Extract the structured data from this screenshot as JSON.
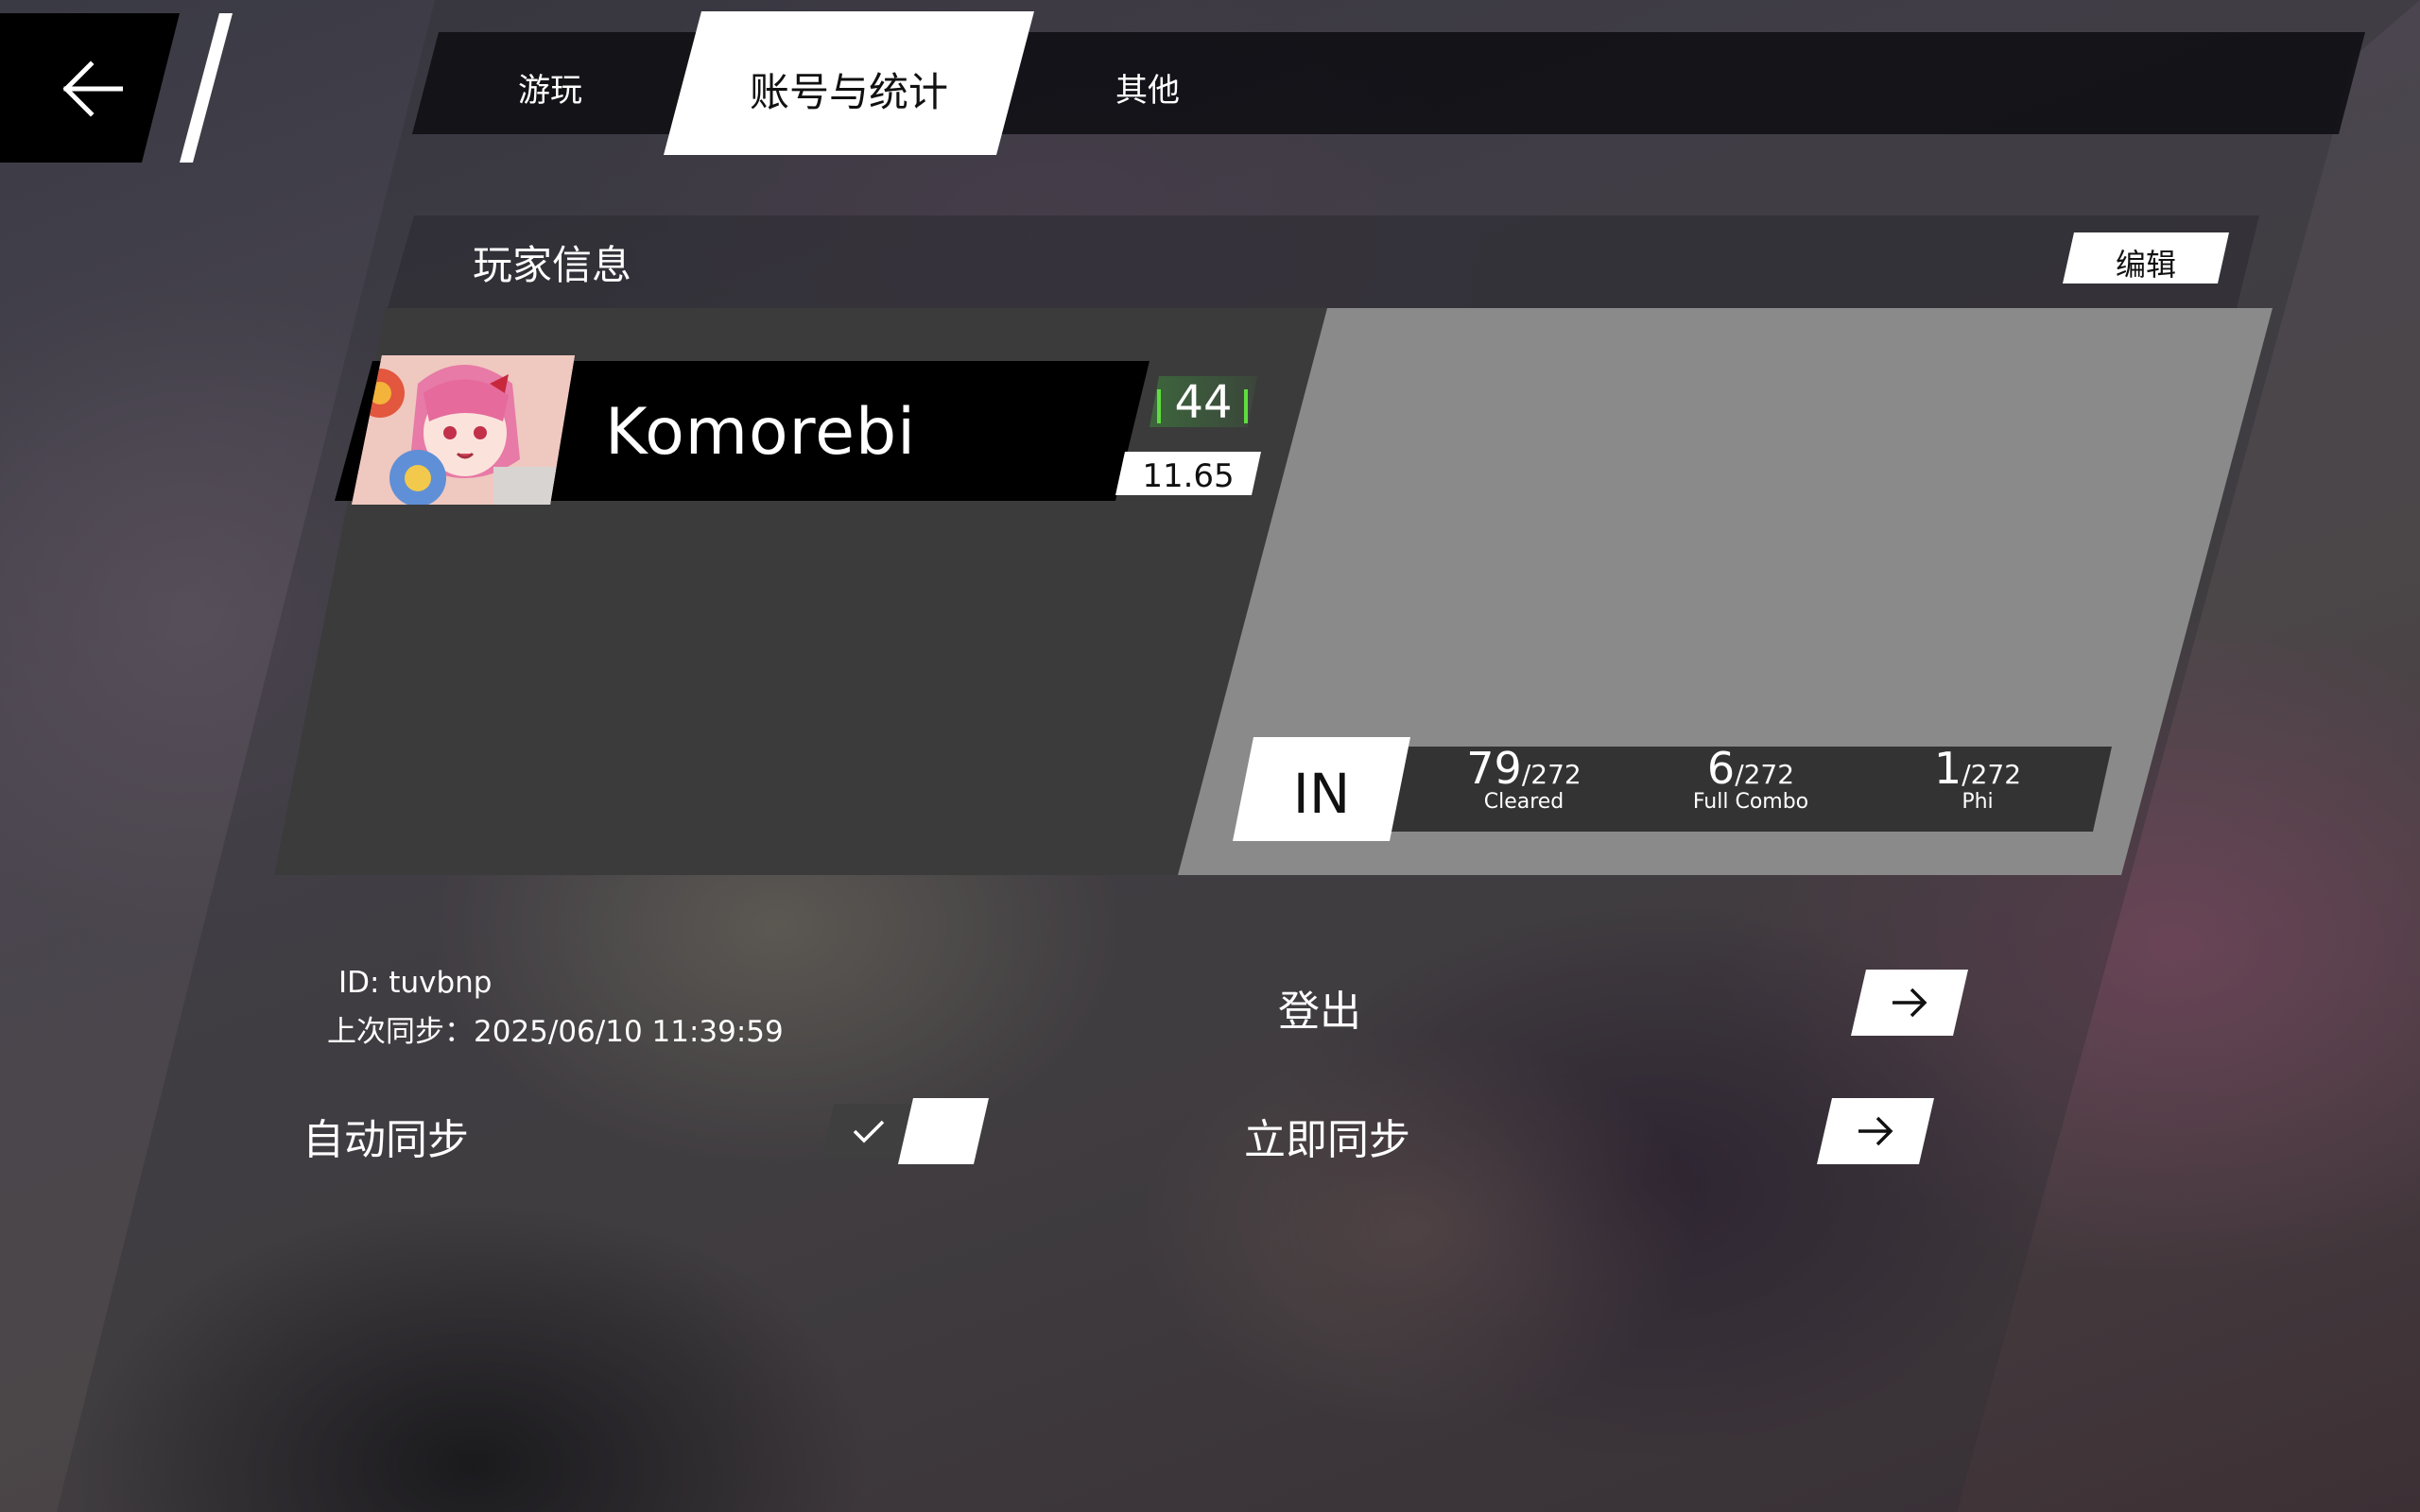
{
  "tabs": [
    {
      "label": "游玩"
    },
    {
      "label": "账号与统计",
      "active": true
    },
    {
      "label": "其他"
    }
  ],
  "section": {
    "title": "玩家信息",
    "edit_label": "编辑"
  },
  "player": {
    "name": "Komorebi",
    "level": "44",
    "rks": "11.65"
  },
  "difficulty": "IN",
  "stats": [
    {
      "value": "79",
      "total": "/272",
      "label": "Cleared"
    },
    {
      "value": "6",
      "total": "/272",
      "label": "Full Combo"
    },
    {
      "value": "1",
      "total": "/272",
      "label": "Phi"
    }
  ],
  "account": {
    "id_text": "ID: tuvbnp",
    "last_sync": "上次同步：2025/06/10 11:39:59",
    "logout_label": "登出",
    "auto_sync_label": "自动同步",
    "auto_sync_enabled": true,
    "sync_now_label": "立即同步"
  },
  "icons": {
    "back": "arrow-left-icon",
    "arrow": "arrow-right-icon",
    "check": "checkmark-icon"
  },
  "colors": {
    "level_accent": "#5fdc3f",
    "card_dark": "#3b3b3b",
    "card_light": "#8a8a8a"
  }
}
